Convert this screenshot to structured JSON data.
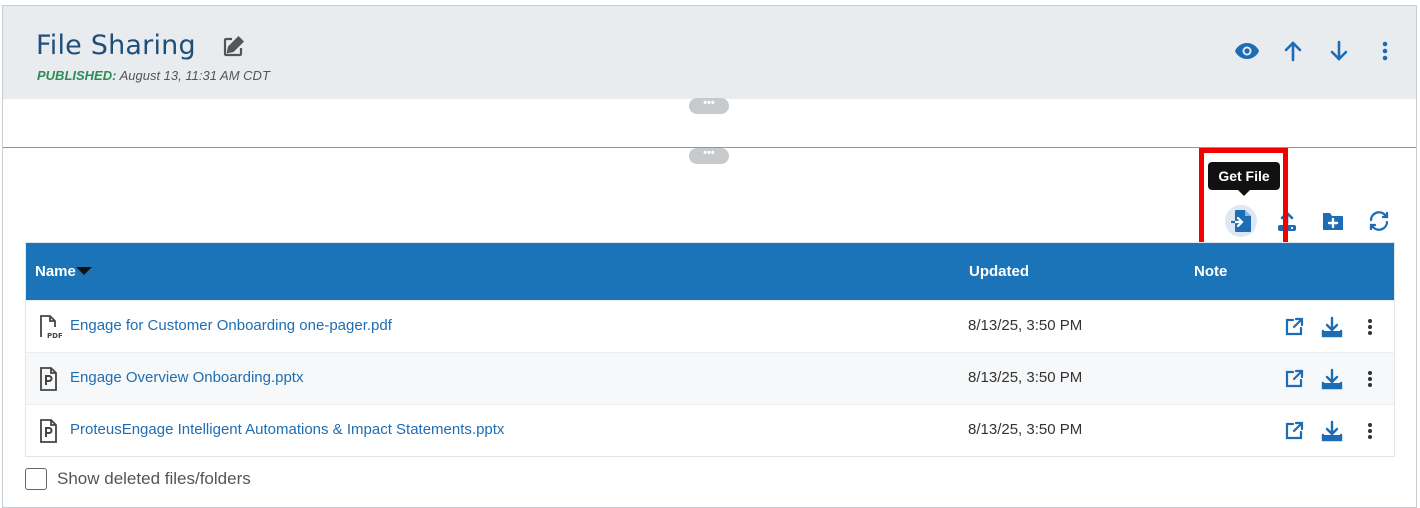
{
  "header": {
    "title": "File Sharing",
    "published_label": "PUBLISHED:",
    "published_value": "August 13, 11:31 AM CDT"
  },
  "icons": {
    "edit": "edit-pencil-icon",
    "preview": "eye-icon",
    "move_up": "arrow-up-icon",
    "move_down": "arrow-down-icon",
    "more": "kebab-menu-icon"
  },
  "handles": {
    "symbol": "•••"
  },
  "toolbar": {
    "tooltip": "Get File",
    "buttons": [
      "get-file",
      "upload",
      "new-folder",
      "refresh"
    ]
  },
  "table": {
    "columns": {
      "name": "Name",
      "updated": "Updated",
      "note": "Note"
    },
    "rows": [
      {
        "name": "Engage for Customer Onboarding one-pager.pdf",
        "type": "pdf",
        "updated": "8/13/25, 3:50 PM",
        "note": ""
      },
      {
        "name": "Engage Overview Onboarding.pptx",
        "type": "pptx",
        "updated": "8/13/25, 3:50 PM",
        "note": ""
      },
      {
        "name": "ProteusEngage Intelligent Automations & Impact Statements.pptx",
        "type": "pptx",
        "updated": "8/13/25, 3:50 PM",
        "note": ""
      }
    ]
  },
  "footer": {
    "show_deleted_label": "Show deleted files/folders",
    "show_deleted_checked": false
  },
  "colors": {
    "accent": "#1c74b8",
    "link": "#1f6db3",
    "published": "#2e8b57",
    "highlight": "#f40000",
    "title": "#1f4e79"
  }
}
